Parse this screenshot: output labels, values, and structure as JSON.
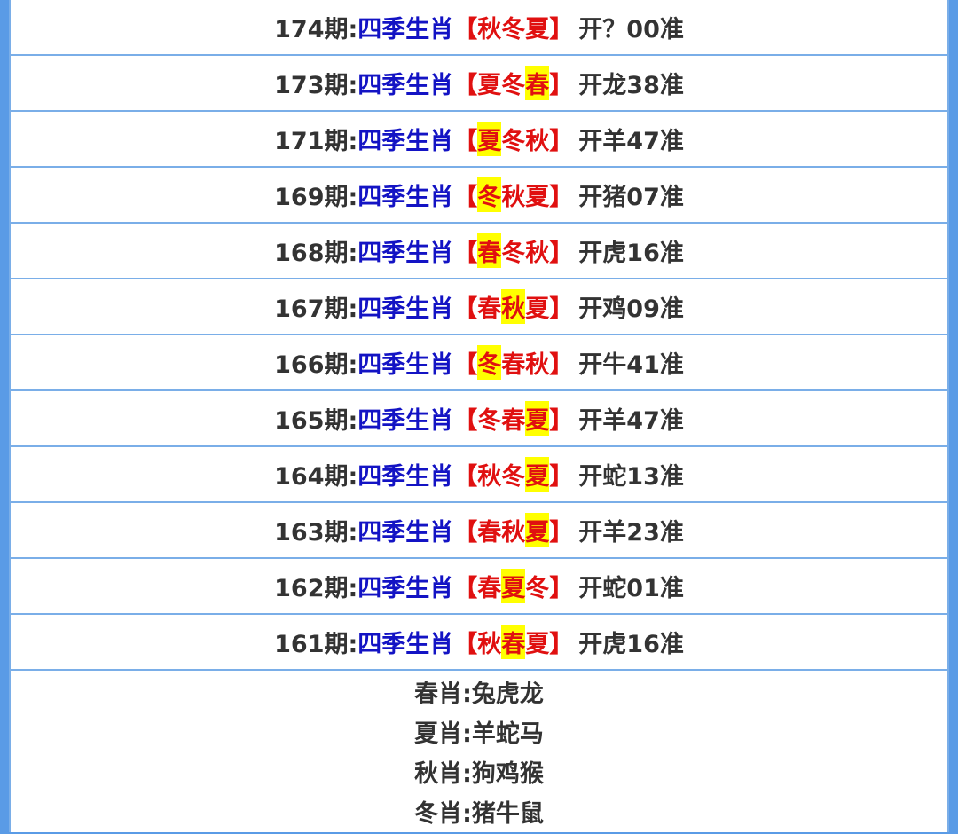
{
  "rows": [
    {
      "period": "174期:",
      "label": "四季生肖",
      "seasons": [
        {
          "t": "秋",
          "hl": false
        },
        {
          "t": "冬",
          "hl": false
        },
        {
          "t": "夏",
          "hl": false
        }
      ],
      "result": "开？00准"
    },
    {
      "period": "173期:",
      "label": "四季生肖",
      "seasons": [
        {
          "t": "夏",
          "hl": false
        },
        {
          "t": "冬",
          "hl": false
        },
        {
          "t": "春",
          "hl": true
        }
      ],
      "result": "开龙38准"
    },
    {
      "period": "171期:",
      "label": "四季生肖",
      "seasons": [
        {
          "t": "夏",
          "hl": true
        },
        {
          "t": "冬",
          "hl": false
        },
        {
          "t": "秋",
          "hl": false
        }
      ],
      "result": "开羊47准"
    },
    {
      "period": "169期:",
      "label": "四季生肖",
      "seasons": [
        {
          "t": "冬",
          "hl": true
        },
        {
          "t": "秋",
          "hl": false
        },
        {
          "t": "夏",
          "hl": false
        }
      ],
      "result": "开猪07准"
    },
    {
      "period": "168期:",
      "label": "四季生肖",
      "seasons": [
        {
          "t": "春",
          "hl": true
        },
        {
          "t": "冬",
          "hl": false
        },
        {
          "t": "秋",
          "hl": false
        }
      ],
      "result": "开虎16准"
    },
    {
      "period": "167期:",
      "label": "四季生肖",
      "seasons": [
        {
          "t": "春",
          "hl": false
        },
        {
          "t": "秋",
          "hl": true
        },
        {
          "t": "夏",
          "hl": false
        }
      ],
      "result": "开鸡09准"
    },
    {
      "period": "166期:",
      "label": "四季生肖",
      "seasons": [
        {
          "t": "冬",
          "hl": true
        },
        {
          "t": "春",
          "hl": false
        },
        {
          "t": "秋",
          "hl": false
        }
      ],
      "result": "开牛41准"
    },
    {
      "period": "165期:",
      "label": "四季生肖",
      "seasons": [
        {
          "t": "冬",
          "hl": false
        },
        {
          "t": "春",
          "hl": false
        },
        {
          "t": "夏",
          "hl": true
        }
      ],
      "result": "开羊47准"
    },
    {
      "period": "164期:",
      "label": "四季生肖",
      "seasons": [
        {
          "t": "秋",
          "hl": false
        },
        {
          "t": "冬",
          "hl": false
        },
        {
          "t": "夏",
          "hl": true
        }
      ],
      "result": "开蛇13准"
    },
    {
      "period": "163期:",
      "label": "四季生肖",
      "seasons": [
        {
          "t": "春",
          "hl": false
        },
        {
          "t": "秋",
          "hl": false
        },
        {
          "t": "夏",
          "hl": true
        }
      ],
      "result": "开羊23准"
    },
    {
      "period": "162期:",
      "label": "四季生肖",
      "seasons": [
        {
          "t": "春",
          "hl": false
        },
        {
          "t": "夏",
          "hl": true
        },
        {
          "t": "冬",
          "hl": false
        }
      ],
      "result": "开蛇01准"
    },
    {
      "period": "161期:",
      "label": "四季生肖",
      "seasons": [
        {
          "t": "秋",
          "hl": false
        },
        {
          "t": "春",
          "hl": true
        },
        {
          "t": "夏",
          "hl": false
        }
      ],
      "result": "开虎16准"
    }
  ],
  "brackets": {
    "open": "【",
    "close": "】"
  },
  "legend": [
    "春肖:兔虎龙",
    "夏肖:羊蛇马",
    "秋肖:狗鸡猴",
    "冬肖:猪牛鼠"
  ],
  "colors": {
    "period_text": "#333333",
    "label_text": "#1313c4",
    "season_text": "#e01010",
    "highlight": "#ffff00",
    "border": "#7aaee8",
    "frame": "#5a9be6"
  }
}
